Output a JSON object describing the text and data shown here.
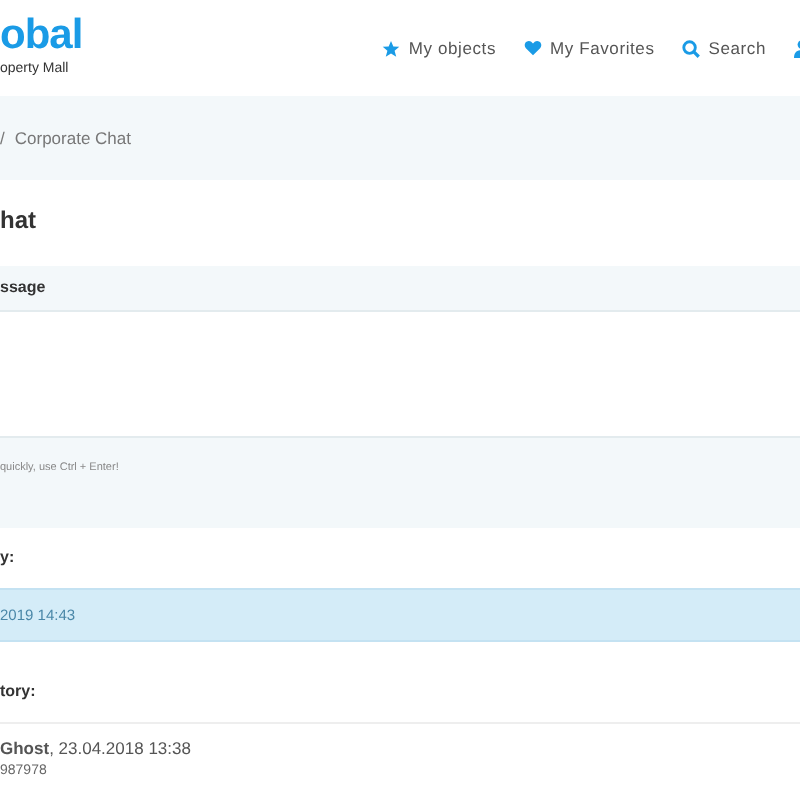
{
  "logo": {
    "name": "obal",
    "tagline": "operty Mall"
  },
  "nav": [
    {
      "kind": "star",
      "label": "My objects"
    },
    {
      "kind": "heart",
      "label": "My Favorites"
    },
    {
      "kind": "search",
      "label": "Search"
    },
    {
      "kind": "user"
    }
  ],
  "breadcrumb": {
    "prefix": "/",
    "current": "Corporate Chat"
  },
  "title": "hat",
  "message_panel": {
    "heading": "ssage",
    "hint": "quickly, use Ctrl + Enter!"
  },
  "section_1": {
    "heading": "y:",
    "notice": "2019 14:43"
  },
  "section_2": {
    "heading": "tory:",
    "entries": [
      {
        "author": "**Ghost**, 23.04.2018 13:38",
        "text": "987978"
      }
    ]
  }
}
